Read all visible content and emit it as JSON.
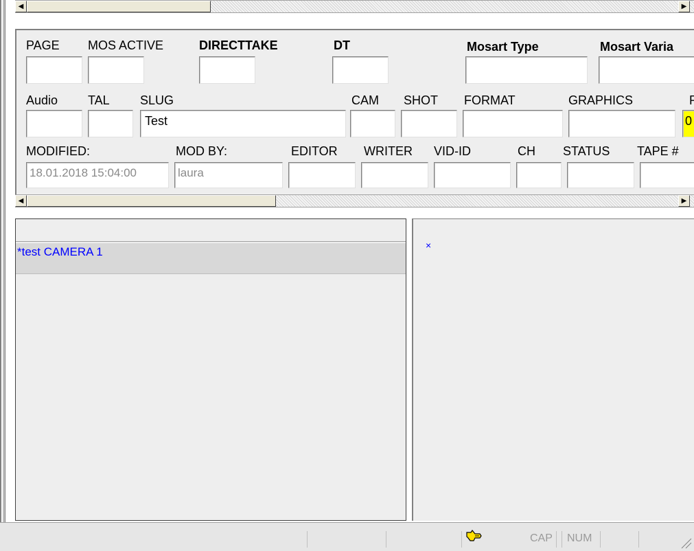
{
  "fields": {
    "row1": {
      "page_label": "PAGE",
      "mos_active_label": "MOS ACTIVE",
      "directtake_label": "DIRECTTAKE",
      "dt_label": "DT",
      "mosart_type_label": "Mosart Type",
      "mosart_variant_label": "Mosart Varia"
    },
    "row2": {
      "audio_label": "Audio",
      "tal_label": "TAL",
      "slug_label": "SLUG",
      "slug_value": "Test",
      "cam_label": "CAM",
      "shot_label": "SHOT",
      "format_label": "FORMAT",
      "graphics_label": "GRAPHICS",
      "cut_label": "R",
      "cut_value": "0"
    },
    "row3": {
      "modified_label": "MODIFIED:",
      "modified_value": "18.01.2018 15:04:00",
      "mod_by_label": "MOD BY:",
      "mod_by_value": "laura",
      "editor_label": "EDITOR",
      "writer_label": "WRITER",
      "vid_id_label": "VID-ID",
      "ch_label": "CH",
      "status_label": "STATUS",
      "tape_label": "TAPE #"
    }
  },
  "list": {
    "items": [
      {
        "label": "*test CAMERA 1"
      }
    ]
  },
  "right_pane": {
    "marker": "×"
  },
  "statusbar": {
    "cap": "CAP",
    "num": "NUM"
  },
  "colors": {
    "panel_bg": "#eeeeee",
    "link_text": "#0000ff",
    "highlight": "#ffff00"
  }
}
